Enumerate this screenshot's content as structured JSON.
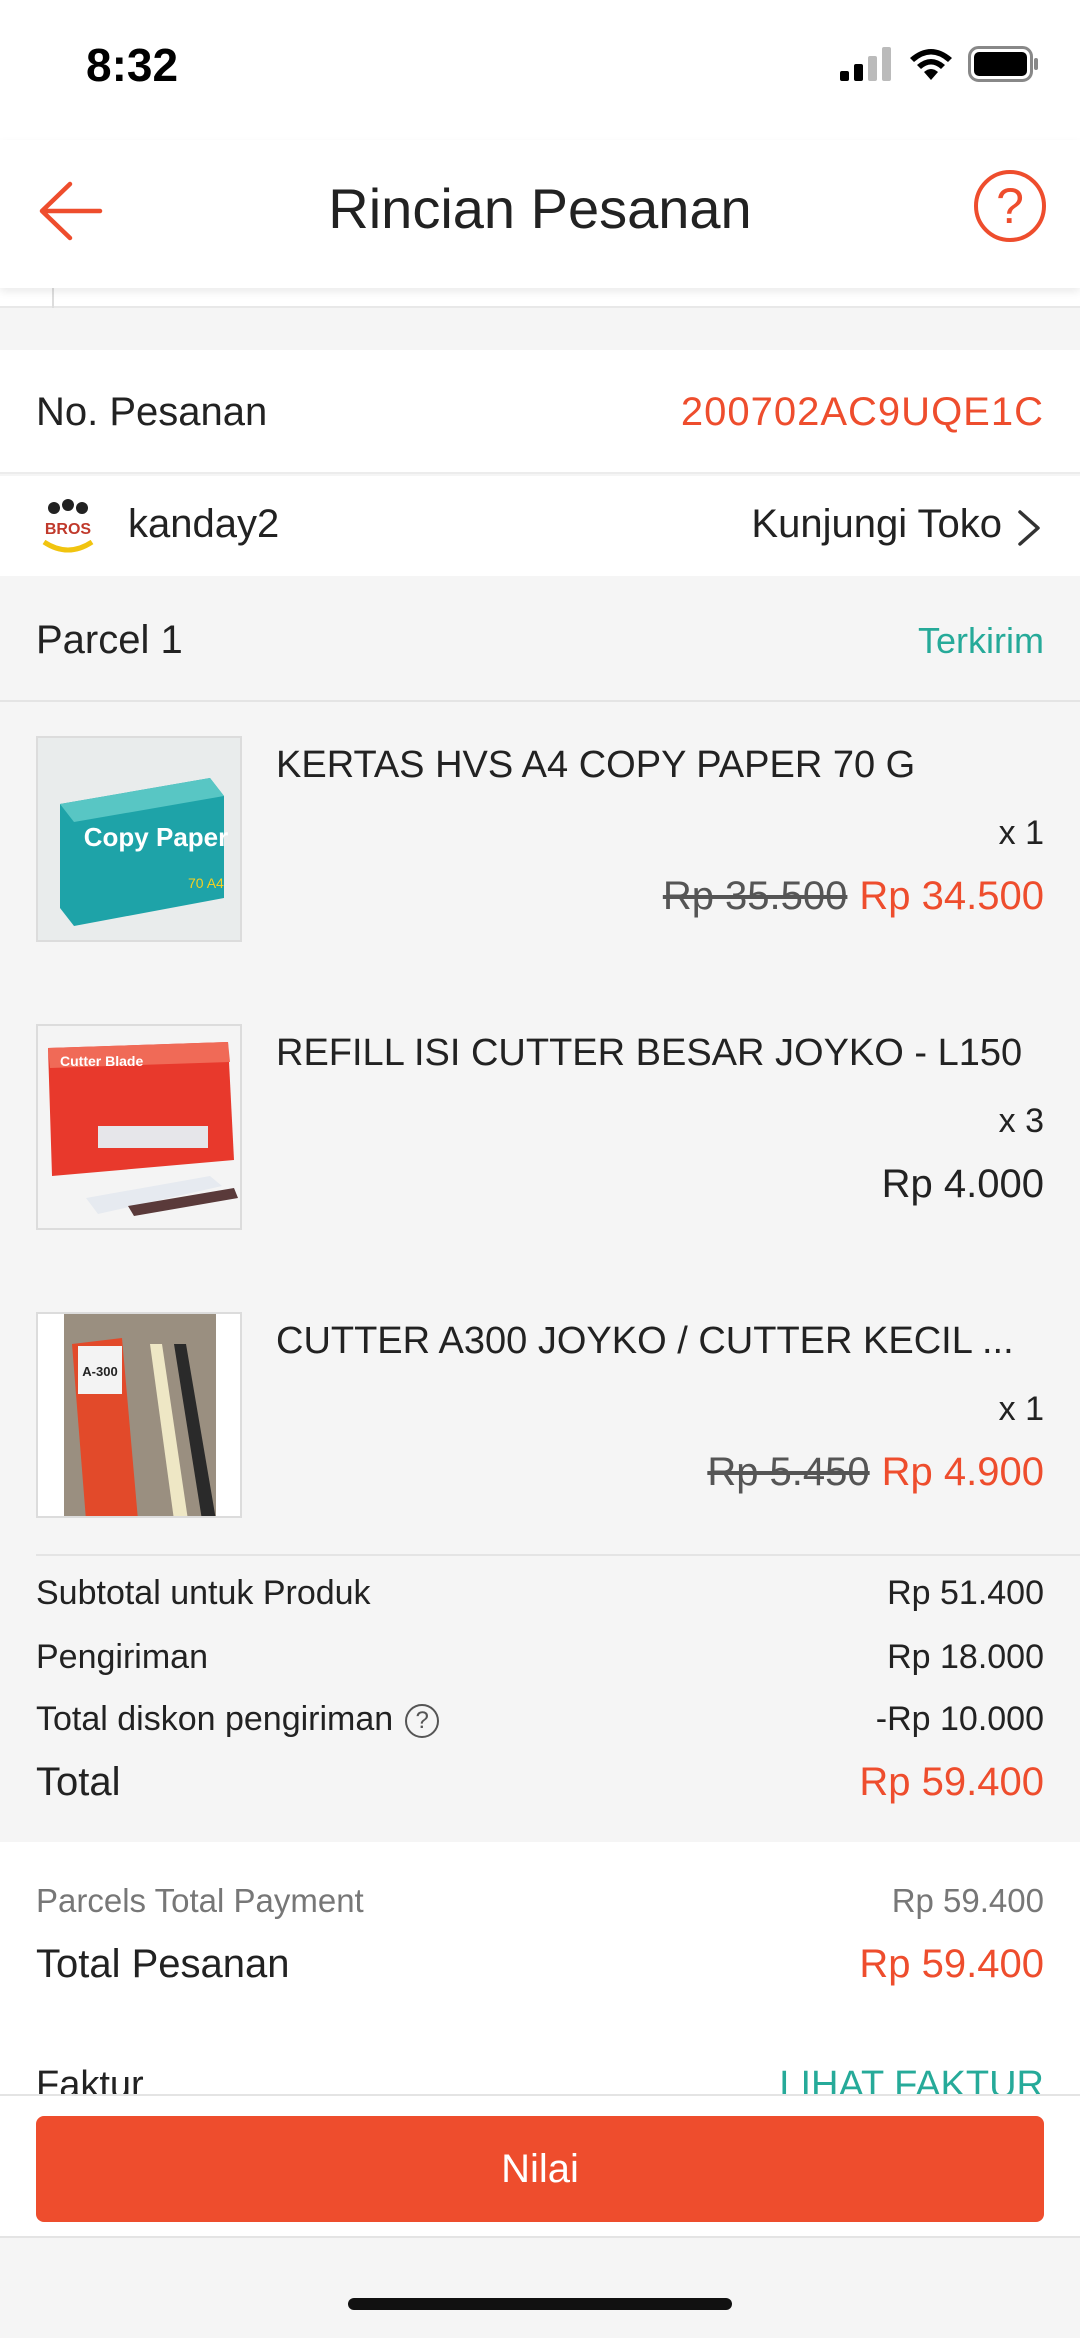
{
  "status_bar": {
    "time": "8:32"
  },
  "header": {
    "title": "Rincian Pesanan",
    "help_glyph": "?"
  },
  "order": {
    "number_label": "No. Pesanan",
    "number_value": "200702AC9UQE1C"
  },
  "shop": {
    "name": "kanday2",
    "visit_label": "Kunjungi Toko",
    "logo_text": "BROS"
  },
  "parcel": {
    "label": "Parcel 1",
    "status": "Terkirim"
  },
  "items": [
    {
      "name": "KERTAS HVS A4 COPY PAPER 70 G",
      "qty": "x 1",
      "price_original": "Rp 35.500",
      "price": "Rp 34.500",
      "thumb_text": "Copy Paper"
    },
    {
      "name": "REFILL ISI CUTTER BESAR JOYKO - L150",
      "qty": "x 3",
      "price": "Rp 4.000",
      "thumb_text": "Cutter Blade"
    },
    {
      "name": "CUTTER A300 JOYKO / CUTTER KECIL ...",
      "qty": "x 1",
      "price_original": "Rp 5.450",
      "price": "Rp 4.900",
      "thumb_text": "A-300"
    }
  ],
  "summary": {
    "subtotal_label": "Subtotal untuk Produk",
    "subtotal_value": "Rp 51.400",
    "shipping_label": "Pengiriman",
    "shipping_value": "Rp 18.000",
    "shipping_discount_label": "Total diskon pengiriman",
    "shipping_discount_value": "-Rp 10.000",
    "help_glyph": "?",
    "total_label": "Total",
    "total_value": "Rp 59.400"
  },
  "payment": {
    "parcels_total_label": "Parcels Total Payment",
    "parcels_total_value": "Rp 59.400",
    "order_total_label": "Total Pesanan",
    "order_total_value": "Rp 59.400",
    "invoice_label": "Faktur",
    "invoice_link": "LIHAT FAKTUR"
  },
  "actions": {
    "rate_label": "Nilai"
  },
  "colors": {
    "accent": "#ee4d2d",
    "status_green": "#26aa99"
  }
}
